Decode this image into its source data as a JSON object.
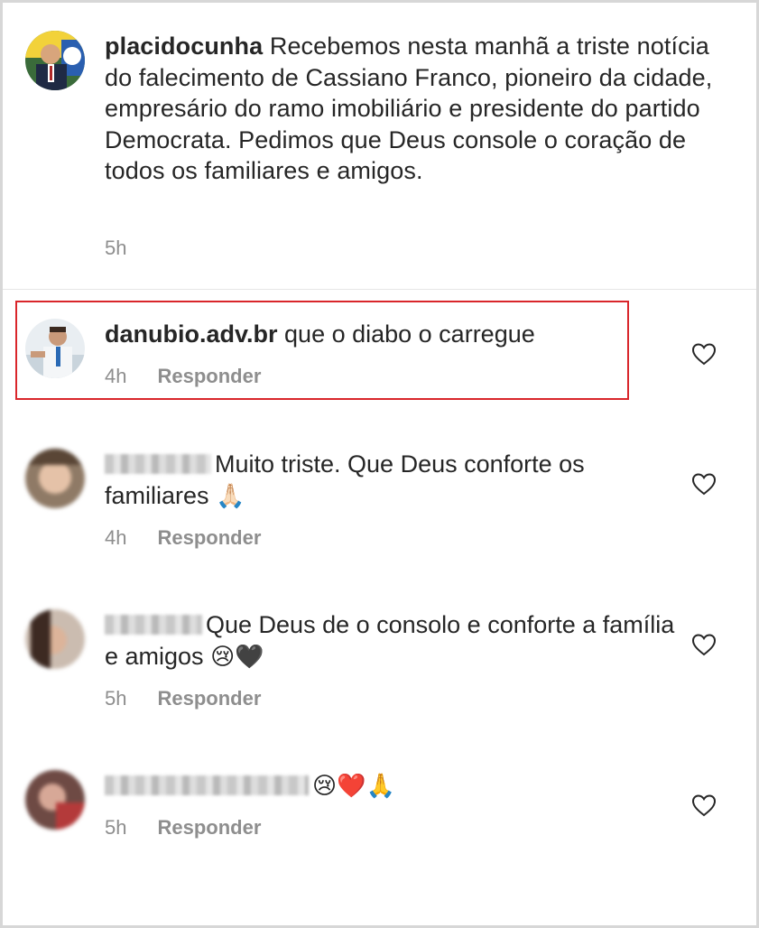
{
  "caption": {
    "username": "placidocunha",
    "text": "Recebemos nesta manhã a triste notícia do falecimento de Cassiano Franco, pioneiro da cidade, empresário do ramo imobiliário e presidente do partido Democrata. Pedimos que Deus console o coração de todos os familiares e amigos.",
    "time": "5h"
  },
  "comments": [
    {
      "username": "danubio.adv.br",
      "text": "que o diabo o carregue",
      "time": "4h",
      "reply_label": "Responder",
      "highlighted": true
    },
    {
      "username": "",
      "text": "Muito triste. Que Deus conforte os familiares",
      "emoji": "🙏🏻",
      "time": "4h",
      "reply_label": "Responder"
    },
    {
      "username": "",
      "text": "Que Deus de o consolo e conforte a família e amigos",
      "emoji": "😢🖤",
      "time": "5h",
      "reply_label": "Responder"
    },
    {
      "username": "",
      "text": "",
      "emoji": "😢❤️🙏",
      "time": "5h",
      "reply_label": "Responder"
    }
  ],
  "colors": {
    "text": "#262626",
    "meta": "#8e8e8e",
    "highlight_border": "#d9262b",
    "heart": "#262626"
  },
  "icons": {
    "like": "heart-outline-icon"
  }
}
